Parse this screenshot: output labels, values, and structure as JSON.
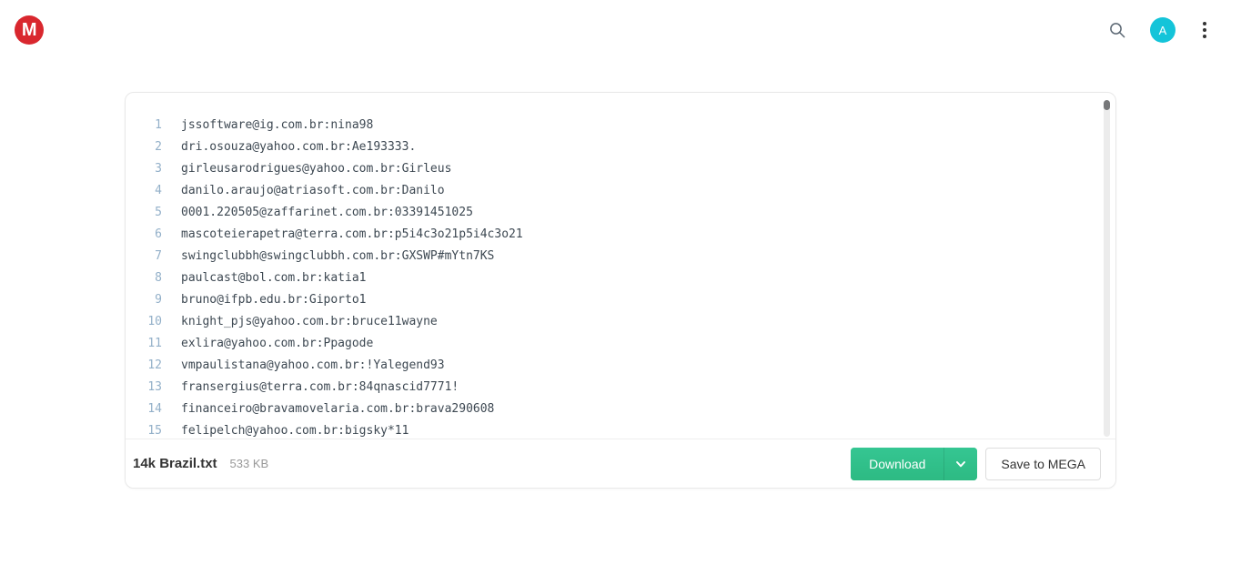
{
  "header": {
    "logo_letter": "M",
    "logo_color": "#d9272e",
    "search_icon": "search-icon",
    "avatar_letter": "A",
    "avatar_color": "#14c4d9",
    "menu_icon": "vertical-dots-icon"
  },
  "viewer": {
    "lines": [
      {
        "n": "1",
        "text": "jssoftware@ig.com.br:nina98"
      },
      {
        "n": "2",
        "text": "dri.osouza@yahoo.com.br:Ae193333."
      },
      {
        "n": "3",
        "text": "girleusarodrigues@yahoo.com.br:Girleus"
      },
      {
        "n": "4",
        "text": "danilo.araujo@atriasoft.com.br:Danilo"
      },
      {
        "n": "5",
        "text": "0001.220505@zaffarinet.com.br:03391451025"
      },
      {
        "n": "6",
        "text": "mascoteierapetra@terra.com.br:p5i4c3o21p5i4c3o21"
      },
      {
        "n": "7",
        "text": "swingclubbh@swingclubbh.com.br:GXSWP#mYtn7KS"
      },
      {
        "n": "8",
        "text": "paulcast@bol.com.br:katia1"
      },
      {
        "n": "9",
        "text": "bruno@ifpb.edu.br:Giporto1"
      },
      {
        "n": "10",
        "text": "knight_pjs@yahoo.com.br:bruce11wayne"
      },
      {
        "n": "11",
        "text": "exlira@yahoo.com.br:Ppagode"
      },
      {
        "n": "12",
        "text": "vmpaulistana@yahoo.com.br:!Yalegend93"
      },
      {
        "n": "13",
        "text": "fransergius@terra.com.br:84qnascid7771!"
      },
      {
        "n": "14",
        "text": "financeiro@bravamovelaria.com.br:brava290608"
      },
      {
        "n": "15",
        "text": "felipelch@yahoo.com.br:bigsky*11"
      }
    ]
  },
  "footer": {
    "file_name": "14k Brazil.txt",
    "file_size": "533 KB",
    "download_label": "Download",
    "download_caret_icon": "chevron-down-icon",
    "save_label": "Save to MEGA",
    "accent_color": "#31c08a"
  }
}
